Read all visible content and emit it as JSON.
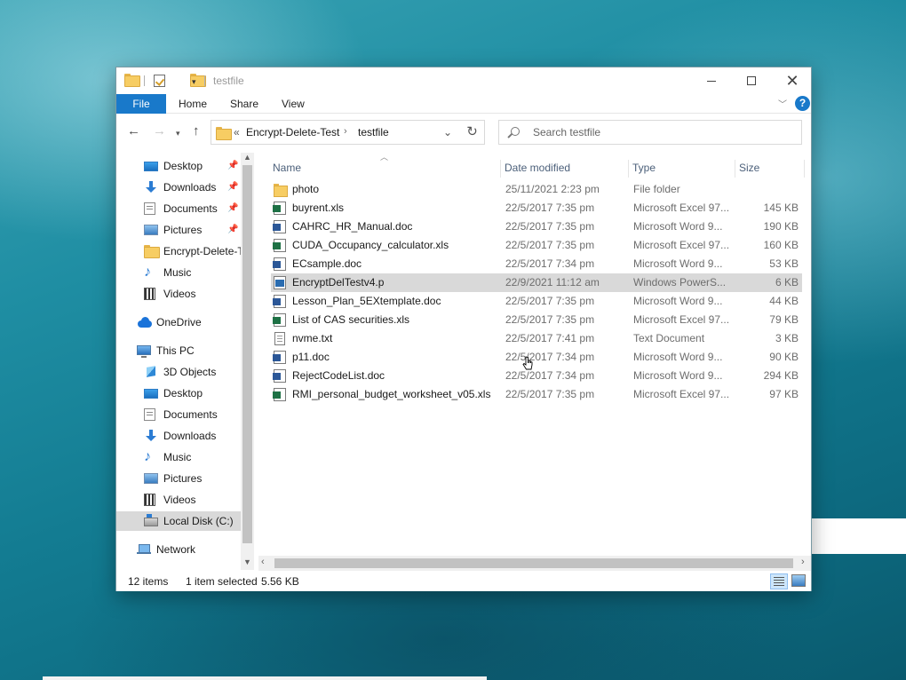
{
  "window": {
    "title": "testfile"
  },
  "ribbon": {
    "tabs": [
      "File",
      "Home",
      "Share",
      "View"
    ]
  },
  "navbar": {
    "address_overflow": "«",
    "path": [
      "Encrypt-Delete-Test",
      "testfile"
    ],
    "path_separator": "›",
    "search_placeholder": "Search testfile"
  },
  "navpane": {
    "items": [
      {
        "label": "Desktop",
        "icon": "desktop-icon",
        "pinned": true
      },
      {
        "label": "Downloads",
        "icon": "downloads-icon",
        "pinned": true
      },
      {
        "label": "Documents",
        "icon": "documents-icon",
        "pinned": true
      },
      {
        "label": "Pictures",
        "icon": "pictures-icon",
        "pinned": true
      },
      {
        "label": "Encrypt-Delete-Test",
        "icon": "folder-icon",
        "pinned": false
      },
      {
        "label": "Music",
        "icon": "music-icon",
        "pinned": false
      },
      {
        "label": "Videos",
        "icon": "videos-icon",
        "pinned": false
      },
      {
        "label": "OneDrive",
        "icon": "onedrive-icon",
        "pinned": false
      },
      {
        "label": "This PC",
        "icon": "this-pc-icon",
        "pinned": false
      },
      {
        "label": "3D Objects",
        "icon": "3d-objects-icon",
        "pinned": false
      },
      {
        "label": "Desktop",
        "icon": "desktop-icon",
        "pinned": false
      },
      {
        "label": "Documents",
        "icon": "documents-icon",
        "pinned": false
      },
      {
        "label": "Downloads",
        "icon": "downloads-icon",
        "pinned": false
      },
      {
        "label": "Music",
        "icon": "music-icon",
        "pinned": false
      },
      {
        "label": "Pictures",
        "icon": "pictures-icon",
        "pinned": false
      },
      {
        "label": "Videos",
        "icon": "videos-icon",
        "pinned": false
      },
      {
        "label": "Local Disk (C:)",
        "icon": "local-disk-icon",
        "pinned": false,
        "selected": true
      },
      {
        "label": "Network",
        "icon": "network-icon",
        "pinned": false
      }
    ]
  },
  "filelist": {
    "columns": {
      "name": "Name",
      "date": "Date modified",
      "type": "Type",
      "size": "Size"
    },
    "rows": [
      {
        "name": "photo",
        "date": "25/11/2021 2:23 pm",
        "type": "File folder",
        "size": "",
        "icon": "folder-icon"
      },
      {
        "name": "buyrent.xls",
        "date": "22/5/2017 7:35 pm",
        "type": "Microsoft Excel 97...",
        "size": "145 KB",
        "icon": "excel-file-icon"
      },
      {
        "name": "CAHRC_HR_Manual.doc",
        "date": "22/5/2017 7:35 pm",
        "type": "Microsoft Word 9...",
        "size": "190 KB",
        "icon": "word-file-icon"
      },
      {
        "name": "CUDA_Occupancy_calculator.xls",
        "date": "22/5/2017 7:35 pm",
        "type": "Microsoft Excel 97...",
        "size": "160 KB",
        "icon": "excel-file-icon"
      },
      {
        "name": "ECsample.doc",
        "date": "22/5/2017 7:34 pm",
        "type": "Microsoft Word 9...",
        "size": "53 KB",
        "icon": "word-file-icon"
      },
      {
        "name": "EncryptDelTestv4.p",
        "date": "22/9/2021 11:12 am",
        "type": "Windows PowerS...",
        "size": "6 KB",
        "icon": "powershell-file-icon",
        "selected": true
      },
      {
        "name": "Lesson_Plan_5EXtemplate.doc",
        "date": "22/5/2017 7:35 pm",
        "type": "Microsoft Word 9...",
        "size": "44 KB",
        "icon": "word-file-icon"
      },
      {
        "name": "List of CAS securities.xls",
        "date": "22/5/2017 7:35 pm",
        "type": "Microsoft Excel 97...",
        "size": "79 KB",
        "icon": "excel-file-icon"
      },
      {
        "name": "nvme.txt",
        "date": "22/5/2017 7:41 pm",
        "type": "Text Document",
        "size": "3 KB",
        "icon": "text-file-icon"
      },
      {
        "name": "p11.doc",
        "date": "22/5/2017 7:34 pm",
        "type": "Microsoft Word 9...",
        "size": "90 KB",
        "icon": "word-file-icon"
      },
      {
        "name": "RejectCodeList.doc",
        "date": "22/5/2017 7:34 pm",
        "type": "Microsoft Word 9...",
        "size": "294 KB",
        "icon": "word-file-icon"
      },
      {
        "name": "RMI_personal_budget_worksheet_v05.xls",
        "date": "22/5/2017 7:35 pm",
        "type": "Microsoft Excel 97...",
        "size": "97 KB",
        "icon": "excel-file-icon"
      }
    ]
  },
  "statusbar": {
    "count": "12 items",
    "selection": "1 item selected",
    "size": "5.56 KB"
  },
  "colors": {
    "accent": "#1979ca",
    "selection": "#d9d9d9",
    "header_text": "#4c607a"
  }
}
